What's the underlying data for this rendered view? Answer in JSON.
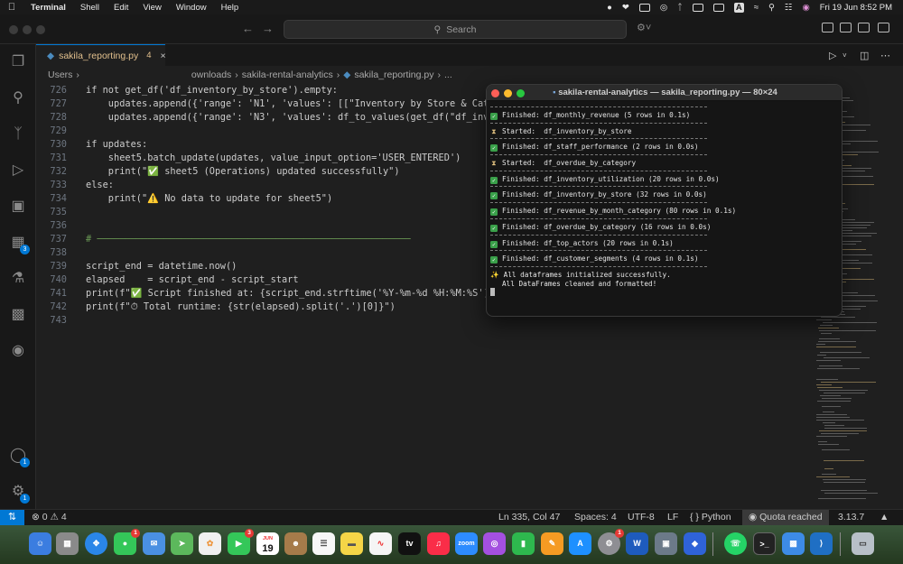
{
  "menubar": {
    "app_name": "Terminal",
    "items": [
      "Shell",
      "Edit",
      "View",
      "Window",
      "Help"
    ],
    "clock": "Fri 19 Jun  8:52 PM"
  },
  "vscode": {
    "search_placeholder": "Search",
    "tab": {
      "filename": "sakila_reporting.py",
      "problems": "4"
    },
    "breadcrumb": [
      "Users",
      "ownloads",
      "sakila-rental-analytics",
      "sakila_reporting.py",
      "..."
    ],
    "code_lines": [
      {
        "n": "726",
        "text": "if not get_df('df_inventory_by_store').empty:"
      },
      {
        "n": "727",
        "text": "    updates.append({'range': 'N1', 'values': [[\"Inventory by Store & Categ"
      },
      {
        "n": "728",
        "text": "    updates.append({'range': 'N3', 'values': df_to_values(get_df(\"df_inven"
      },
      {
        "n": "729",
        "text": ""
      },
      {
        "n": "730",
        "text": "if updates:"
      },
      {
        "n": "731",
        "text": "    sheet5.batch_update(updates, value_input_option='USER_ENTERED')"
      },
      {
        "n": "732",
        "text": "    print(\"✅ sheet5 (Operations) updated successfully\")"
      },
      {
        "n": "733",
        "text": "else:"
      },
      {
        "n": "734",
        "text": "    print(\"⚠️ No data to update for sheet5\")"
      },
      {
        "n": "735",
        "text": ""
      },
      {
        "n": "736",
        "text": ""
      },
      {
        "n": "737",
        "text": "# ────────────────────────────────────────────────────────"
      },
      {
        "n": "738",
        "text": ""
      },
      {
        "n": "739",
        "text": "script_end = datetime.now()"
      },
      {
        "n": "740",
        "text": "elapsed    = script_end - script_start"
      },
      {
        "n": "741",
        "text": "print(f\"✅ Script finished at: {script_end.strftime('%Y-%m-%d %H:%M:%S')}\")"
      },
      {
        "n": "742",
        "text": "print(f\"⏱ Total runtime: {str(elapsed).split('.')[0]}\")"
      },
      {
        "n": "743",
        "text": ""
      }
    ],
    "status": {
      "errors": "0",
      "warnings": "4",
      "position": "Ln 335, Col 47",
      "spaces": "Spaces: 4",
      "encoding": "UTF-8",
      "eol": "LF",
      "language": "Python",
      "quota": "Quota reached",
      "python_version": "3.13.7"
    },
    "badges": {
      "extensions": "3",
      "accounts": "1",
      "settings": "1"
    }
  },
  "terminal": {
    "title": "sakila-rental-analytics — sakila_reporting.py — 80×24",
    "lines": [
      {
        "kind": "done",
        "text": "Finished: df_monthly_revenue (5 rows in 0.1s)"
      },
      {
        "kind": "start",
        "text": "Started:  df_inventory_by_store"
      },
      {
        "kind": "done",
        "text": "Finished: df_staff_performance (2 rows in 0.0s)"
      },
      {
        "kind": "start",
        "text": "Started:  df_overdue_by_category"
      },
      {
        "kind": "done",
        "text": "Finished: df_inventory_utilization (20 rows in 0.0s)"
      },
      {
        "kind": "done",
        "text": "Finished: df_inventory_by_store (32 rows in 0.0s)"
      },
      {
        "kind": "done",
        "text": "Finished: df_revenue_by_month_category (80 rows in 0.1s)"
      },
      {
        "kind": "done",
        "text": "Finished: df_overdue_by_category (16 rows in 0.0s)"
      },
      {
        "kind": "done",
        "text": "Finished: df_top_actors (20 rows in 0.1s)"
      },
      {
        "kind": "done",
        "text": "Finished: df_customer_segments (4 rows in 0.1s)"
      }
    ],
    "final_1": "All dataframes initialized successfully.",
    "final_2": "All DataFrames cleaned and formatted!"
  },
  "dock": {
    "calendar_month": "JUN",
    "calendar_day": "19",
    "tv_label": "tv",
    "zoom_label": "zoom",
    "word_label": "W",
    "badges": {
      "messages": "1",
      "facetime": "3",
      "settings": "1"
    }
  }
}
